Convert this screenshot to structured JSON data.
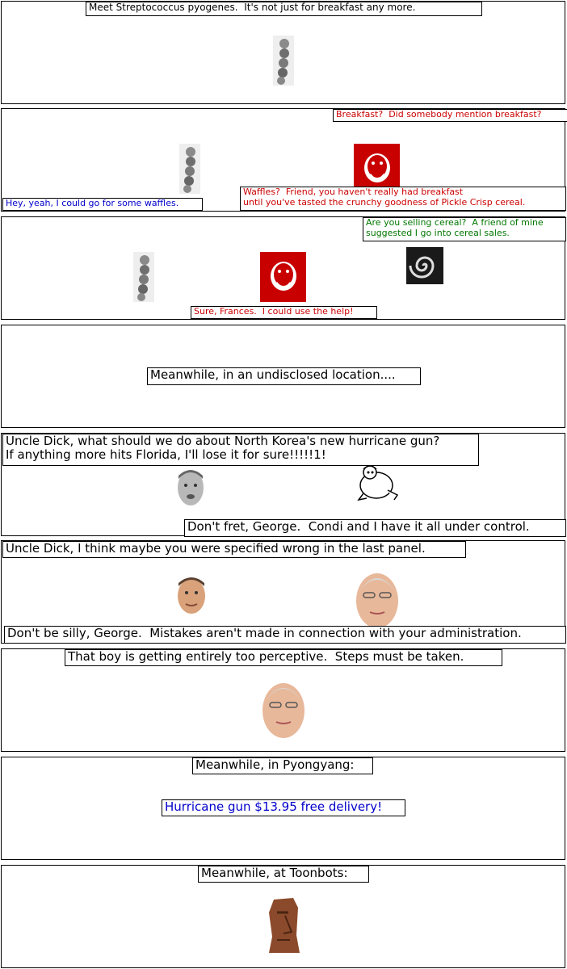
{
  "panels": [
    {
      "captions": [
        "Meet Streptococcus pyogenes.  It's not just for breakfast any more."
      ]
    },
    {
      "captions": [
        "Breakfast?  Did somebody mention breakfast?",
        "Hey, yeah, I could go for some waffles.",
        "Waffles?  Friend, you haven't really had breakfast\nuntil you've tasted the crunchy goodness of Pickle Crisp cereal."
      ]
    },
    {
      "captions": [
        "Are you selling cereal?  A friend of mine\nsuggested I go into cereal sales.",
        "Sure, Frances.  I could use the help!"
      ]
    },
    {
      "captions": [
        "Meanwhile, in an undisclosed location...."
      ]
    },
    {
      "captions": [
        "Uncle Dick, what should we do about North Korea's new hurricane gun?\nIf anything more hits Florida, I'll lose it for sure!!!!!1!",
        "Don't fret, George.  Condi and I have it all under control."
      ]
    },
    {
      "captions": [
        "Uncle Dick, I think maybe you were specified wrong in the last panel.",
        "Don't be silly, George.  Mistakes aren't made in connection with your administration."
      ]
    },
    {
      "captions": [
        "That boy is getting entirely too perceptive.  Steps must be taken."
      ]
    },
    {
      "captions": [
        "Meanwhile, in Pyongyang:",
        "Hurricane gun $13.95 free delivery!"
      ]
    },
    {
      "captions": [
        "Meanwhile, at Toonbots:"
      ]
    }
  ],
  "colors": {
    "red": "#cc0000",
    "blue": "#0000cc",
    "green": "#007700",
    "border": "#000000"
  }
}
